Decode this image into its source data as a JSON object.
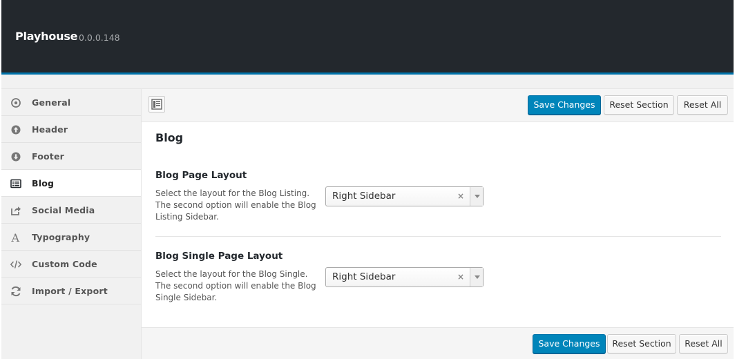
{
  "app": {
    "title": "Playhouse",
    "version": "0.0.0.148"
  },
  "sidebar": {
    "items": [
      {
        "label": "General",
        "icon": "circle-dot-icon"
      },
      {
        "label": "Header",
        "icon": "arrow-up-circle-icon"
      },
      {
        "label": "Footer",
        "icon": "arrow-down-circle-icon"
      },
      {
        "label": "Blog",
        "icon": "list-icon",
        "active": true
      },
      {
        "label": "Social Media",
        "icon": "share-icon"
      },
      {
        "label": "Typography",
        "icon": "typography-icon"
      },
      {
        "label": "Custom Code",
        "icon": "code-icon"
      },
      {
        "label": "Import / Export",
        "icon": "refresh-icon"
      }
    ]
  },
  "toolbar": {
    "save_label": "Save Changes",
    "reset_section_label": "Reset Section",
    "reset_all_label": "Reset All"
  },
  "section": {
    "title": "Blog",
    "fields": [
      {
        "title": "Blog Page Layout",
        "desc_lines": [
          "Select the layout for the Blog Listing.",
          "The second option will enable the Blog",
          "Listing Sidebar."
        ],
        "value": "Right Sidebar",
        "clear": "×"
      },
      {
        "title": "Blog Single Page Layout",
        "desc_lines": [
          "Select the layout for the Blog Single.",
          "The second option will enable the Blog",
          "Single Sidebar."
        ],
        "value": "Right Sidebar",
        "clear": "×"
      }
    ]
  },
  "footer": {
    "save_label": "Save Changes",
    "reset_section_label": "Reset Section",
    "reset_all_label": "Reset All"
  },
  "colors": {
    "accent": "#0073aa",
    "primary_button": "#0085ba",
    "header_bg": "#23282d"
  }
}
